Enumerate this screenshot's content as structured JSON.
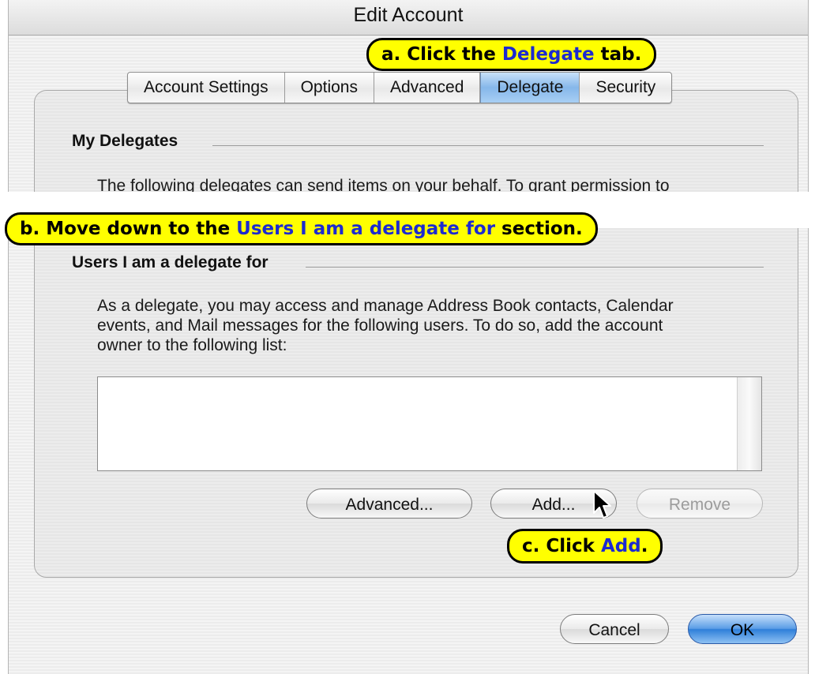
{
  "window": {
    "title": "Edit Account"
  },
  "tabs": [
    {
      "label": "Account Settings",
      "active": false
    },
    {
      "label": "Options",
      "active": false
    },
    {
      "label": "Advanced",
      "active": false
    },
    {
      "label": "Delegate",
      "active": true
    },
    {
      "label": "Security",
      "active": false
    }
  ],
  "my_delegates": {
    "heading": "My Delegates",
    "text": "The following delegates can send items on your behalf. To grant permission to"
  },
  "users_delegate": {
    "heading": "Users I am a delegate for",
    "text_lines": [
      "As a delegate, you may access and manage Address Book contacts, Calendar",
      "events, and Mail messages for the following users. To do so, add the account",
      "owner to the following list:"
    ]
  },
  "buttons": {
    "advanced": "Advanced...",
    "add": "Add...",
    "remove": "Remove",
    "cancel": "Cancel",
    "ok": "OK"
  },
  "callouts": {
    "a": {
      "prefix": "a.  Click the ",
      "highlight": "Delegate",
      "suffix": " tab."
    },
    "b": {
      "prefix": "b. Move down to the ",
      "highlight": "Users I am a delegate for",
      "suffix": " section."
    },
    "c": {
      "prefix": "c.  Click ",
      "highlight": "Add",
      "suffix": "."
    }
  },
  "colors": {
    "callout_bg": "#ffff00",
    "callout_highlight": "#1c2ad1",
    "active_tab": "#86b7ea",
    "default_button": "#2f7fd9"
  }
}
